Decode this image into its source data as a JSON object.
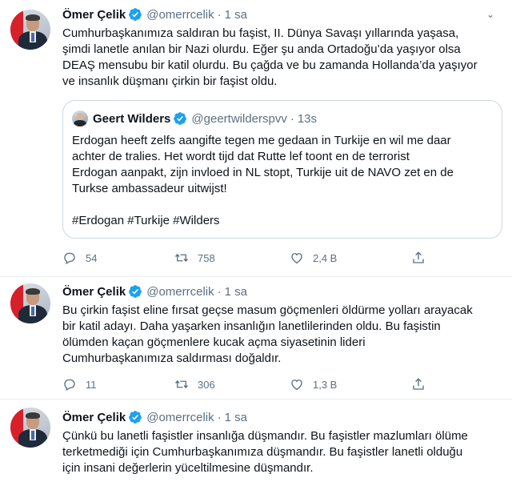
{
  "tweets": [
    {
      "name": "Ömer Çelik",
      "handle": "@omerrcelik",
      "time": "1 sa",
      "text": "Cumhurbaşkanımıza saldıran bu faşist, II. Dünya Savaşı yıllarında yaşasa,\nşimdi lanetle anılan bir Nazi olurdu. Eğer şu anda Ortadoğu’da yaşıyor olsa\nDEAŞ mensubu bir katil olurdu. Bu çağda ve bu zamanda Hollanda’da yaşıyor\nve insanlık düşmanı çirkin bir faşist oldu.",
      "quote": {
        "name": "Geert Wilders",
        "handle": "@geertwilderspvv",
        "time": "13s",
        "text": "Erdogan heeft zelfs aangifte tegen me gedaan in Turkije en wil me daar\nachter de tralies. Het wordt tijd dat Rutte lef toont en de terrorist\nErdogan aanpakt, zijn invloed in NL stopt, Turkije uit de NAVO zet en de\nTurkse ambassadeur uitwijst!\n\n#Erdogan #Turkije #Wilders"
      },
      "replies": "54",
      "retweets": "758",
      "likes": "2,4 B"
    },
    {
      "name": "Ömer Çelik",
      "handle": "@omerrcelik",
      "time": "1 sa",
      "text": "Bu çirkin faşist eline fırsat geçse masum göçmenleri öldürme yolları arayacak\nbir katil adayı. Daha yaşarken insanlığın lanetlilerinden oldu. Bu faşistin\nölümden kaçan göçmenlere kucak açma siyasetinin lideri\nCumhurbaşkanımıza saldırması doğaldır.",
      "replies": "11",
      "retweets": "306",
      "likes": "1,3 B"
    },
    {
      "name": "Ömer Çelik",
      "handle": "@omerrcelik",
      "time": "1 sa",
      "text": "Çünkü bu lanetli faşistler insanlığa düşmandır. Bu faşistler mazlumları ölüme\nterketmediği için Cumhurbaşkanımıza düşmandır. Bu faşistler lanetli olduğu\niçin insani değerlerin yüceltilmesine düşmandır."
    }
  ],
  "icons": {
    "verified": "verified-badge-icon",
    "reply": "reply-icon",
    "retweet": "retweet-icon",
    "like": "heart-icon",
    "share": "share-icon",
    "more": "chevron-down-icon"
  },
  "colors": {
    "verified": "#1da1f2",
    "text": "#0f1419",
    "secondary": "#5b7083",
    "border": "#ebeef0",
    "quote_border": "#cfd9de"
  }
}
